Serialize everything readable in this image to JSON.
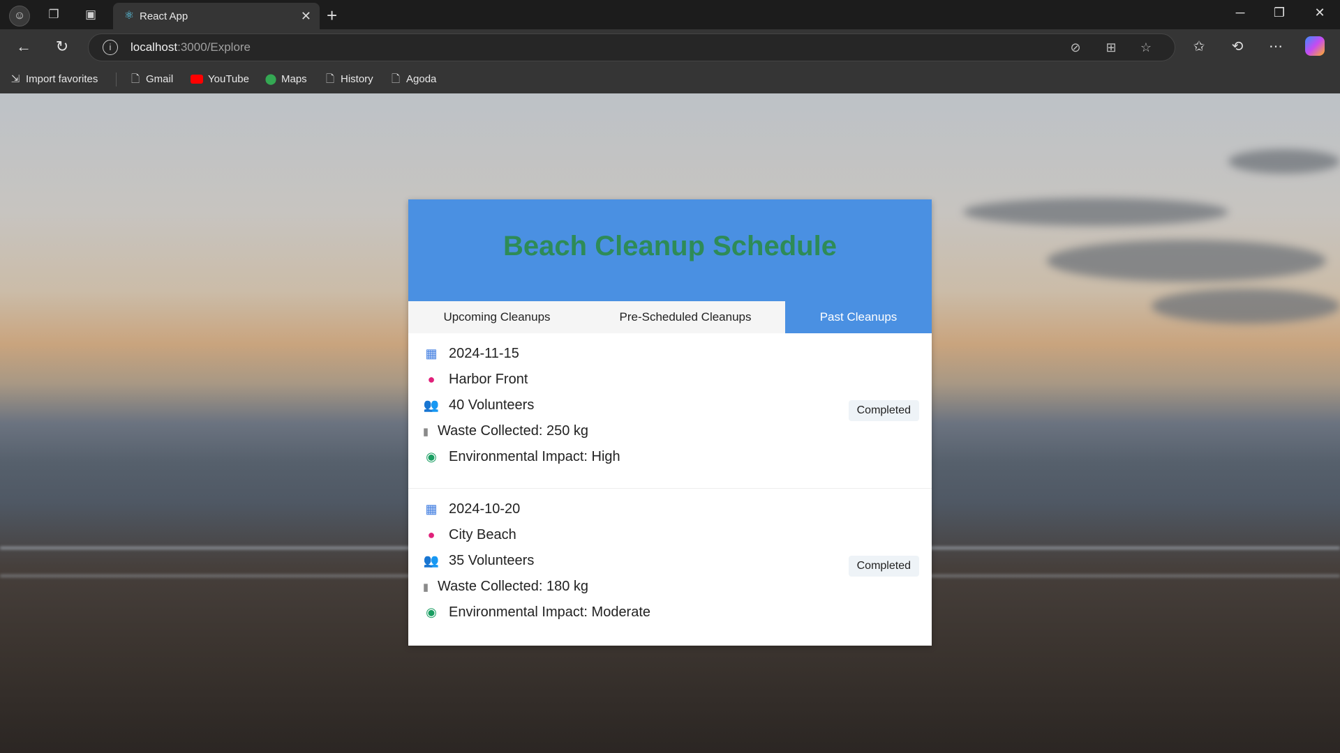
{
  "browser": {
    "tab_title": "React App",
    "url_host": "localhost",
    "url_path": ":3000/Explore",
    "bookmarks": [
      {
        "label": "Import favorites",
        "icon": "import-icon"
      },
      {
        "label": "Gmail",
        "icon": "page-icon"
      },
      {
        "label": "YouTube",
        "icon": "youtube-icon"
      },
      {
        "label": "Maps",
        "icon": "maps-icon"
      },
      {
        "label": "History",
        "icon": "page-icon"
      },
      {
        "label": "Agoda",
        "icon": "page-icon"
      }
    ]
  },
  "app": {
    "title": "Beach Cleanup Schedule",
    "header_color": "#4a90e2",
    "title_color": "#2e8b57",
    "tabs": [
      {
        "label": "Upcoming Cleanups",
        "active": false
      },
      {
        "label": "Pre-Scheduled Cleanups",
        "active": false
      },
      {
        "label": "Past Cleanups",
        "active": true
      }
    ],
    "cleanups": [
      {
        "date": "2024-11-15",
        "location": "Harbor Front",
        "volunteers": "40 Volunteers",
        "waste": "Waste Collected: 250 kg",
        "impact": "Environmental Impact: High",
        "status": "Completed"
      },
      {
        "date": "2024-10-20",
        "location": "City Beach",
        "volunteers": "35 Volunteers",
        "waste": "Waste Collected: 180 kg",
        "impact": "Environmental Impact: Moderate",
        "status": "Completed"
      }
    ]
  }
}
